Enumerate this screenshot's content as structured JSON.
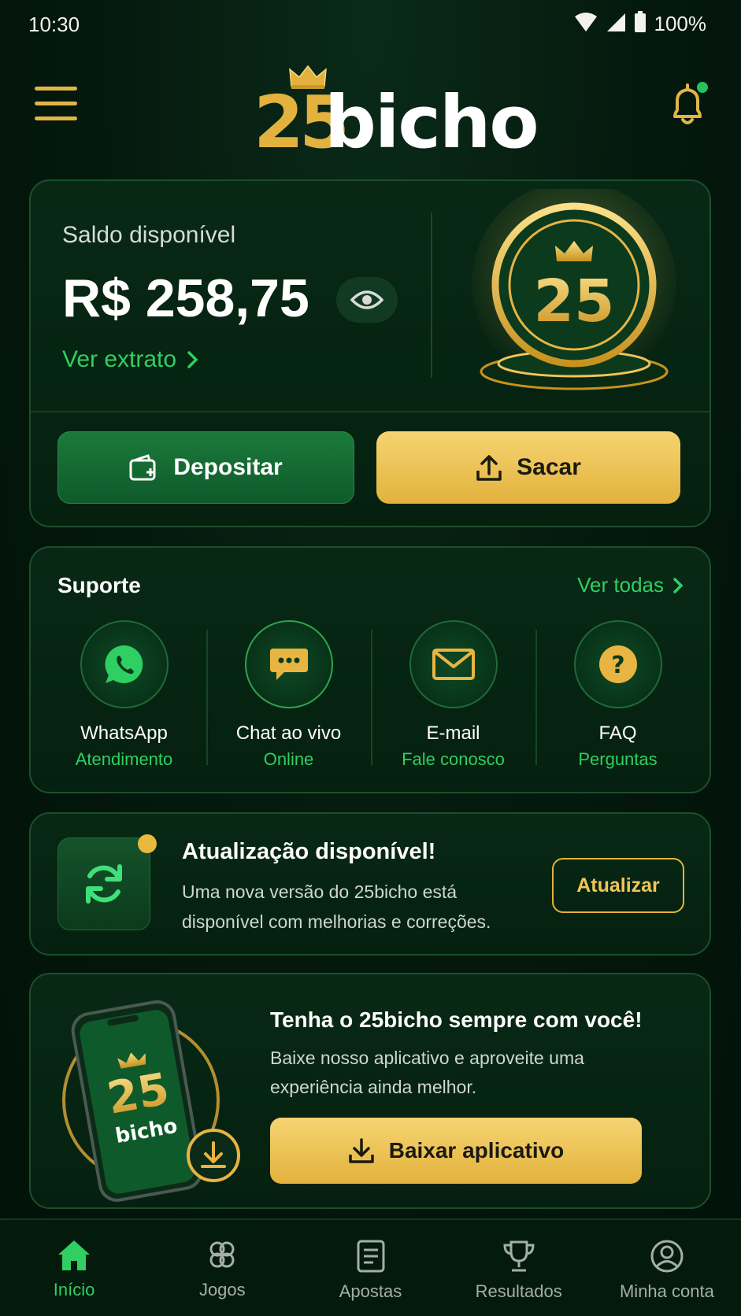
{
  "status_bar": {
    "time": "10:30",
    "battery": "100%",
    "icons": [
      "wifi-icon",
      "signal-icon",
      "battery-icon"
    ]
  },
  "header": {
    "logo_number": "25",
    "logo_word": "bicho",
    "menu_icon": "hamburger-menu-icon",
    "notification_icon": "bell-icon",
    "has_unread_notification": true
  },
  "balance": {
    "label": "Saldo disponível",
    "value": "R$ 258,75",
    "statement_link": "Ver extrato",
    "coin_text": "25",
    "deposit_label": "Depositar",
    "withdraw_label": "Sacar"
  },
  "support": {
    "title": "Suporte",
    "see_all": "Ver todas",
    "items": [
      {
        "name": "WhatsApp",
        "sub": "Atendimento",
        "icon": "whatsapp-icon"
      },
      {
        "name": "Chat ao vivo",
        "sub": "Online",
        "icon": "chat-bubble-icon"
      },
      {
        "name": "E-mail",
        "sub": "Fale conosco",
        "icon": "mail-icon"
      },
      {
        "name": "FAQ",
        "sub": "Perguntas",
        "icon": "question-icon"
      }
    ]
  },
  "update": {
    "title": "Atualização disponível!",
    "description": "Uma nova versão do 25bicho está disponível com melhorias e correções.",
    "button": "Atualizar"
  },
  "app_promo": {
    "title": "Tenha o 25bicho sempre com você!",
    "description": "Baixe nosso aplicativo e aproveite uma experiência ainda melhor.",
    "button": "Baixar aplicativo",
    "phone_logo_number": "25",
    "phone_logo_word": "bicho"
  },
  "bottom_nav": [
    {
      "label": "Início",
      "icon": "home-icon",
      "active": true
    },
    {
      "label": "Jogos",
      "icon": "clover-icon",
      "active": false
    },
    {
      "label": "Apostas",
      "icon": "ticket-icon",
      "active": false
    },
    {
      "label": "Resultados",
      "icon": "trophy-icon",
      "active": false
    },
    {
      "label": "Minha conta",
      "icon": "user-icon",
      "active": false
    }
  ],
  "colors": {
    "background": "#04180d",
    "accent_green": "#2fcf63",
    "accent_gold": "#e2b23c",
    "card_border": "#1c4f2c"
  }
}
